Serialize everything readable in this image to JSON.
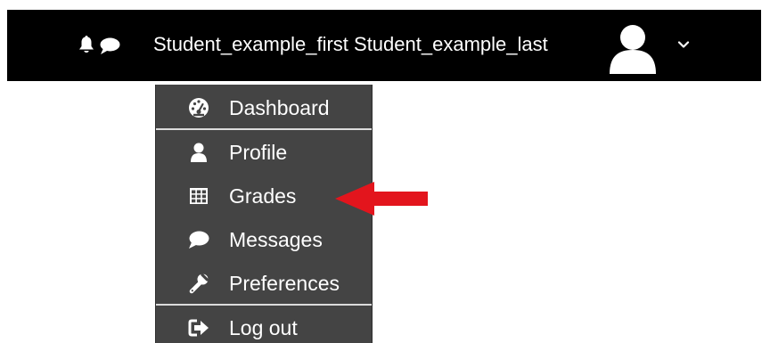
{
  "navbar": {
    "notifications_icon": "bell-icon",
    "messages_icon": "speech-bubble-icon",
    "user_name": "Student_example_first Student_example_last",
    "avatar_icon": "user-avatar-icon",
    "dropdown_icon": "chevron-down-icon"
  },
  "user_menu": {
    "items": [
      {
        "label": "Dashboard",
        "icon": "dashboard-gauge-icon"
      },
      {
        "label": "Profile",
        "icon": "user-icon"
      },
      {
        "label": "Grades",
        "icon": "table-grid-icon"
      },
      {
        "label": "Messages",
        "icon": "speech-bubble-icon"
      },
      {
        "label": "Preferences",
        "icon": "wrench-icon"
      },
      {
        "label": "Log out",
        "icon": "sign-out-icon"
      }
    ]
  },
  "annotation": {
    "arrow_icon": "red-arrow-icon",
    "arrow_color": "#e3151d"
  },
  "colors": {
    "navbar_background": "#000000",
    "menu_background": "#444444",
    "text": "#ffffff"
  }
}
